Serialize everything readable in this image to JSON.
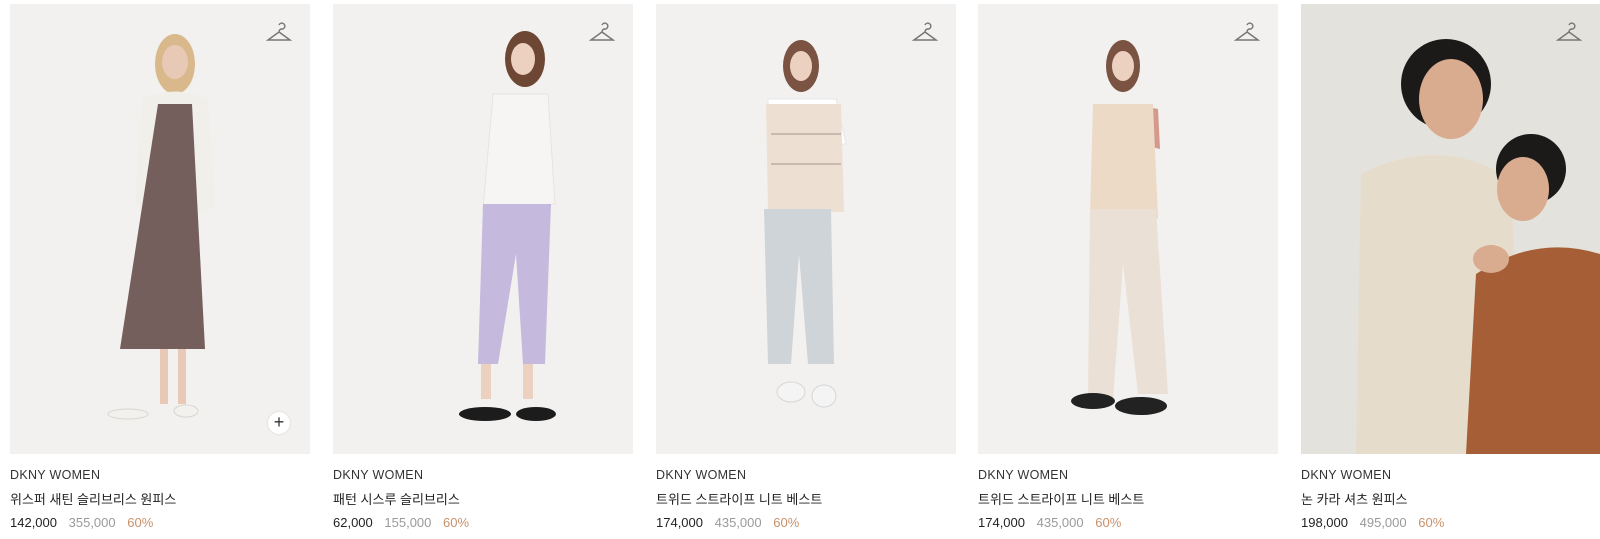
{
  "products": [
    {
      "brand": "DKNY WOMEN",
      "name": "위스퍼 새틴 슬리브리스 원피스",
      "price": "142,000",
      "original_price": "355,000",
      "discount": "60%",
      "has_plus": true,
      "colors": {
        "top": "#f4f2ee",
        "garment": "#755f5c",
        "outer": "#f1efe9",
        "pants": "#755f5c",
        "shoes": "#f3f1ee",
        "skin": "#e7c9b5",
        "hair": "#d9b98c"
      }
    },
    {
      "brand": "DKNY WOMEN",
      "name": "패턴 시스루 슬리브리스",
      "price": "62,000",
      "original_price": "155,000",
      "discount": "60%",
      "has_plus": false,
      "colors": {
        "top": "#f6f5f4",
        "garment": "#c6b9de",
        "outer": "#f6f5f4",
        "pants": "#c6b9de",
        "shoes": "#1c1c1c",
        "skin": "#ecd0c0",
        "hair": "#6e4634"
      }
    },
    {
      "brand": "DKNY WOMEN",
      "name": "트위드 스트라이프 니트 베스트",
      "price": "174,000",
      "original_price": "435,000",
      "discount": "60%",
      "has_plus": false,
      "colors": {
        "top": "#ede0d3",
        "garment": "#cfd4d8",
        "outer": "#ffffff",
        "pants": "#cfd4d8",
        "shoes": "#f4f4f4",
        "skin": "#ecd0c0",
        "hair": "#7a5342"
      }
    },
    {
      "brand": "DKNY WOMEN",
      "name": "트위드 스트라이프 니트 베스트",
      "price": "174,000",
      "original_price": "435,000",
      "discount": "60%",
      "has_plus": false,
      "colors": {
        "top": "#ecd9c6",
        "garment": "#ebe0d5",
        "outer": "#d4998a",
        "pants": "#ebe0d5",
        "shoes": "#222222",
        "skin": "#ecd0c0",
        "hair": "#7a5342"
      }
    },
    {
      "brand": "DKNY WOMEN",
      "name": "논 카라 셔츠 원피스",
      "price": "198,000",
      "original_price": "495,000",
      "discount": "60%",
      "has_plus": false,
      "colors": {
        "top": "#e6dccb",
        "garment": "#a55e35",
        "outer": "#e6dccb",
        "pants": "#e6dccb",
        "shoes": "#a55e35",
        "skin": "#d9ab8f",
        "hair": "#1c1a19"
      }
    }
  ],
  "icons": {
    "wishlist": "hanger-icon",
    "quick_add": "plus-icon"
  },
  "quick_add_glyph": "+"
}
